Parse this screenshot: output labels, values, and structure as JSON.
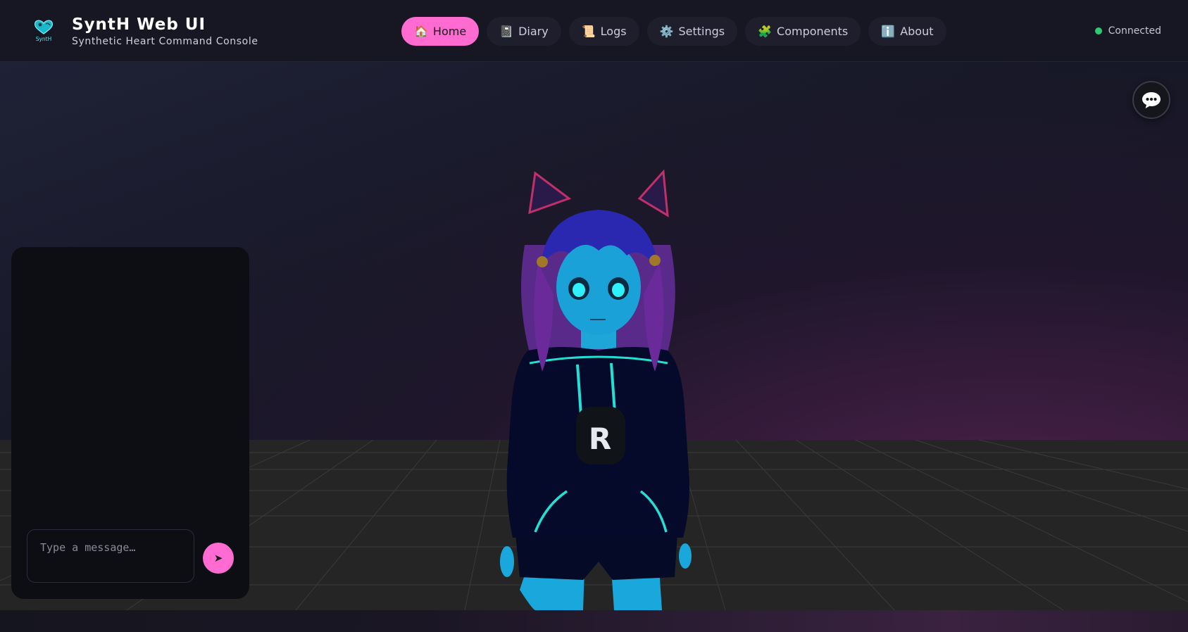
{
  "app": {
    "title": "SyntH Web UI",
    "subtitle": "Synthetic Heart Command Console",
    "logo_text": "SyntH"
  },
  "nav": {
    "tabs": [
      {
        "label": "Home",
        "icon": "🏠",
        "icon_name": "home-icon",
        "active": true
      },
      {
        "label": "Diary",
        "icon": "📓",
        "icon_name": "notebook-icon",
        "active": false
      },
      {
        "label": "Logs",
        "icon": "📜",
        "icon_name": "scroll-icon",
        "active": false
      },
      {
        "label": "Settings",
        "icon": "⚙️",
        "icon_name": "gear-icon",
        "active": false
      },
      {
        "label": "Components",
        "icon": "🧩",
        "icon_name": "puzzle-icon",
        "active": false
      },
      {
        "label": "About",
        "icon": "ℹ️",
        "icon_name": "info-icon",
        "active": false
      }
    ]
  },
  "status": {
    "label": "Connected",
    "color": "#2ecc71"
  },
  "chat": {
    "placeholder": "Type a message…",
    "send_icon": "➤"
  },
  "colors": {
    "accent": "#ff6bd0",
    "header_bg": "#171724",
    "panel_bg": "#0d0d14"
  }
}
